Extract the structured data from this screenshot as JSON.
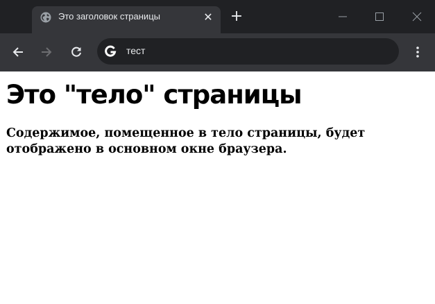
{
  "tab": {
    "title": "Это заголовок страницы",
    "close_symbol": "✕"
  },
  "new_tab_symbol": "+",
  "address_bar": {
    "value": "тест"
  },
  "icons": {
    "tab_favicon": "globe-icon",
    "new_tab": "plus-icon",
    "back": "arrow-left-icon",
    "forward": "arrow-right-icon",
    "reload": "reload-icon",
    "search_engine": "google-g-icon",
    "menu": "kebab-menu-icon",
    "minimize": "minimize-icon",
    "maximize": "maximize-icon",
    "close_window": "close-icon"
  },
  "colors": {
    "frame": "#202124",
    "toolbar": "#35363a",
    "text": "#e8eaed",
    "disabled_icon": "#6d6e71"
  },
  "page": {
    "heading": "Это \"тело\" страницы",
    "paragraph": "Содержимое, помещенное в тело страницы, будет отображено в основном окне браузера."
  }
}
